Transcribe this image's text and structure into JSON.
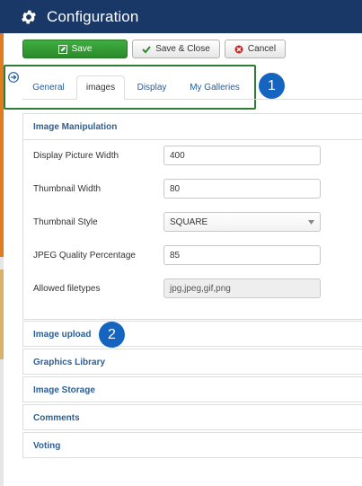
{
  "header": {
    "title": "Configuration",
    "icon": "gear-icon"
  },
  "toolbar": {
    "save_label": "Save",
    "save_close_label": "Save & Close",
    "cancel_label": "Cancel"
  },
  "tabs": [
    {
      "label": "General"
    },
    {
      "label": "images",
      "active": true
    },
    {
      "label": "Display"
    },
    {
      "label": "My Galleries"
    }
  ],
  "badges": [
    "1",
    "2"
  ],
  "image_manipulation": {
    "title": "Image Manipulation",
    "fields": [
      {
        "label": "Display Picture Width",
        "value": "400"
      },
      {
        "label": "Thumbnail Width",
        "value": "80"
      },
      {
        "label": "Thumbnail Style",
        "value": "SQUARE"
      },
      {
        "label": "JPEG Quality Percentage",
        "value": "85"
      },
      {
        "label": "Allowed filetypes",
        "value": "jpg,jpeg,gif,png"
      }
    ]
  },
  "sections": [
    "Image upload",
    "Graphics Library",
    "Image Storage",
    "Comments",
    "Voting"
  ],
  "colors": {
    "header_bg": "#1a3867",
    "save_green": "#2b8a2b",
    "highlight_green": "#2e7d32",
    "badge_blue": "#1565c0",
    "link_blue": "#2b5f95"
  }
}
